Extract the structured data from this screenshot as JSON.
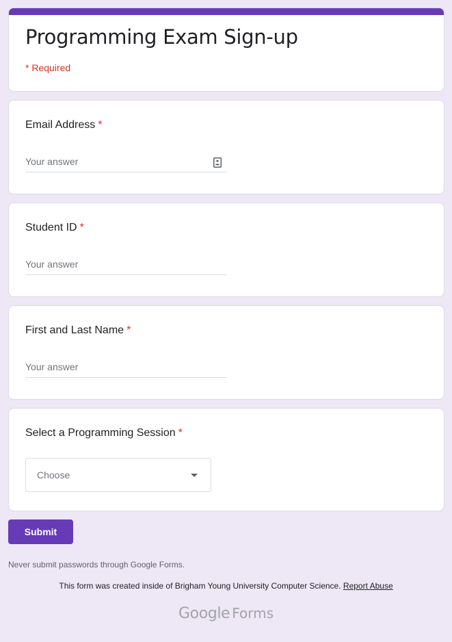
{
  "form": {
    "title": "Programming Exam Sign-up",
    "required_note": "* Required",
    "accent_color": "#673ab7",
    "background_color": "#ede7f6",
    "required_color": "#d93025"
  },
  "questions": [
    {
      "label": "Email Address",
      "required_mark": "*",
      "type": "short-answer",
      "placeholder": "Your answer",
      "icon": "contact-card-icon"
    },
    {
      "label": "Student ID",
      "required_mark": "*",
      "type": "short-answer",
      "placeholder": "Your answer"
    },
    {
      "label": "First and Last Name",
      "required_mark": "*",
      "type": "short-answer",
      "placeholder": "Your answer"
    },
    {
      "label": "Select a Programming Session",
      "required_mark": "*",
      "type": "dropdown",
      "selected": "Choose",
      "icon": "dropdown-arrow-icon"
    }
  ],
  "actions": {
    "submit_label": "Submit"
  },
  "footer": {
    "password_note": "Never submit passwords through Google Forms.",
    "created_text": "This form was created inside of Brigham Young University Computer Science.",
    "report_link": "Report Abuse",
    "brand_google": "Google",
    "brand_forms": "Forms"
  }
}
